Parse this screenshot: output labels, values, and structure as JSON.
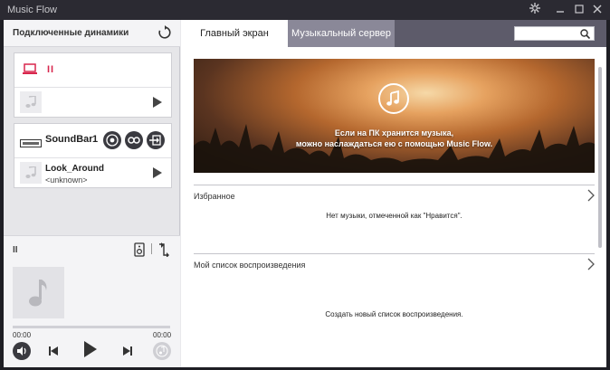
{
  "window": {
    "title": "Music Flow"
  },
  "left": {
    "header_label": "Подключенные динамики",
    "speaker1": {
      "status": "II"
    },
    "speaker2": {
      "name": "SoundBar",
      "count": "1",
      "song": "Look_Around",
      "artist": "<unknown>"
    },
    "player": {
      "status": "II",
      "time_current": "00:00",
      "time_total": "00:00",
      "progress": 0
    }
  },
  "tabs": [
    {
      "label": "Главный экран"
    },
    {
      "label": "Музыкальный сервер"
    }
  ],
  "search": {
    "placeholder": ""
  },
  "banner": {
    "line1": "Если на ПК хранится музыка,",
    "line2": "можно наслаждаться ею с помощью Music Flow."
  },
  "favorites": {
    "title": "Избранное",
    "message": "Нет музыки, отмеченной как \"Нравится\"."
  },
  "playlist": {
    "title": "Мой список воспроизведения",
    "message": "Создать новый список воспроизведения."
  },
  "colors": {
    "accent": "#d8264d",
    "tab_bar": "#5d5b6a",
    "inactive_tab": "#8a8898",
    "titlebar": "#2b2a32"
  }
}
